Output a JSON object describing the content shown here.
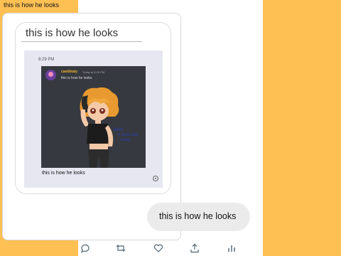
{
  "tweet": {
    "text": "this is how he looks"
  },
  "screenshot": {
    "bubble_title": "this is how he looks",
    "inner_time": "8:29 PM",
    "discord": {
      "username": "caekbtaty",
      "timestamp": "Today at 8:28 PM",
      "message": "this is how he looks",
      "drawing_note": "skirt\nit looks like\nboots"
    },
    "caption": "this is how he looks",
    "reply": "this is how he looks"
  },
  "actions": {
    "icons": [
      "reply-icon",
      "retweet-icon",
      "like-icon",
      "share-icon",
      "analytics-icon"
    ]
  },
  "colors": {
    "background": "#ffc053",
    "discord_bg": "#36393f",
    "username": "#f0b232"
  }
}
